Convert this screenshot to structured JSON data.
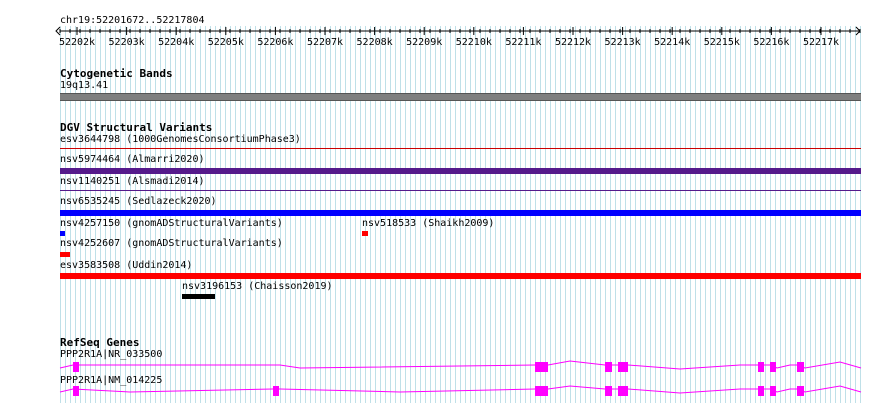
{
  "browser": {
    "location": "chr19:52201672..52217804",
    "ruler_ticks": [
      "52202k",
      "52203k",
      "52204k",
      "52205k",
      "52206k",
      "52207k",
      "52208k",
      "52209k",
      "52210k",
      "52211k",
      "52212k",
      "52213k",
      "52214k",
      "52215k",
      "52216k",
      "52217k"
    ]
  },
  "tracks": {
    "cytoband": {
      "title": "Cytogenetic Bands",
      "band": "19q13.41",
      "color": "#7f7f7f"
    },
    "dgv": {
      "title": "DGV Structural Variants",
      "variants": [
        {
          "label": "esv3644798 (1000GenomesConsortiumPhase3)",
          "color": "#cc0000",
          "style": "thin"
        },
        {
          "label": "nsv5974464 (Almarri2020)",
          "color": "#551a8b",
          "style": "bar"
        },
        {
          "label": "nsv1140251 (Alsmadi2014)",
          "color": "#551a8b",
          "style": "thin"
        },
        {
          "label": "nsv6535245 (Sedlazeck2020)",
          "color": "#0000ff",
          "style": "bar"
        },
        {
          "label": "nsv4257150 (gnomADStructuralVariants)",
          "color": "#0000ff",
          "style": "small"
        },
        {
          "label": "nsv518533 (Shaikh2009)",
          "color": "#ff0000",
          "style": "small"
        },
        {
          "label": "nsv4252607 (gnomADStructuralVariants)",
          "color": "#ff0000",
          "style": "small"
        },
        {
          "label": "esv3583508 (Uddin2014)",
          "color": "#ff0000",
          "style": "bar"
        },
        {
          "label": "nsv3196153 (Chaisson2019)",
          "color": "#000000",
          "style": "bar"
        }
      ]
    },
    "refseq": {
      "title": "RefSeq Genes",
      "genes": [
        {
          "label": "PPP2R1A|NR_033500",
          "color": "#ff00ff"
        },
        {
          "label": "PPP2R1A|NM_014225",
          "color": "#ff00ff"
        }
      ]
    }
  }
}
